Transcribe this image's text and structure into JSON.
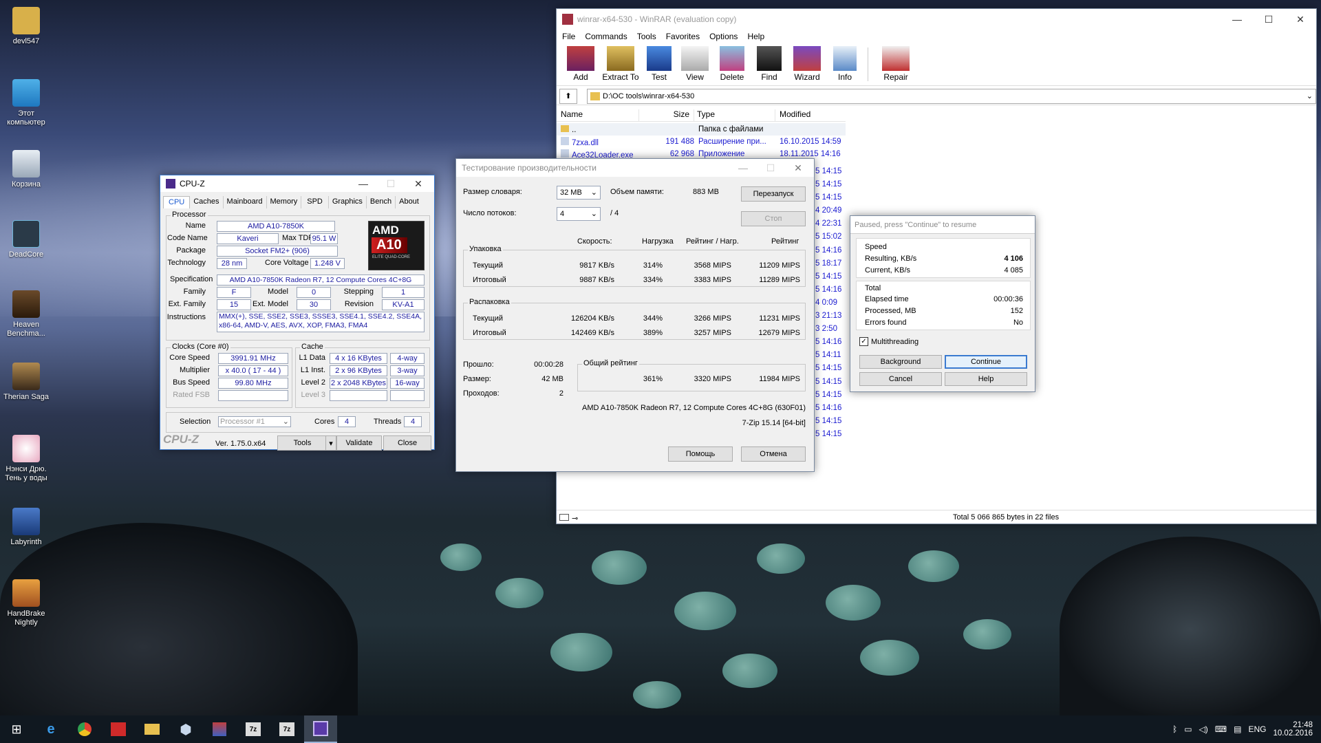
{
  "desktop": {
    "icons": [
      {
        "label": "devl547",
        "name": "user-folder-icon"
      },
      {
        "label": "Этот компьютер",
        "name": "this-pc-icon"
      },
      {
        "label": "Корзина",
        "name": "recycle-bin-icon"
      },
      {
        "label": "DeadCore",
        "name": "deadcore-icon"
      },
      {
        "label": "Heaven Benchma...",
        "name": "heaven-benchmark-icon"
      },
      {
        "label": "Therian Saga",
        "name": "therian-saga-icon"
      },
      {
        "label": "Нэнси Дрю. Тень у воды",
        "name": "nancy-drew-icon"
      },
      {
        "label": "Labyrinth",
        "name": "labyrinth-icon"
      },
      {
        "label": "HandBrake Nightly",
        "name": "handbrake-icon"
      }
    ]
  },
  "winrar": {
    "title": "winrar-x64-530 - WinRAR (evaluation copy)",
    "menu": [
      "File",
      "Commands",
      "Tools",
      "Favorites",
      "Options",
      "Help"
    ],
    "toolbar": [
      "Add",
      "Extract To",
      "Test",
      "View",
      "Delete",
      "Find",
      "Wizard",
      "Info",
      "Repair"
    ],
    "path": "D:\\OC tools\\winrar-x64-530",
    "columns": [
      "Name",
      "Size",
      "Type",
      "Modified"
    ],
    "rows": [
      {
        "name": "..",
        "size": "",
        "type": "Папка с файлами",
        "modified": ""
      },
      {
        "name": "7zxa.dll",
        "size": "191 488",
        "type": "Расширение при...",
        "modified": "16.10.2015 14:59"
      },
      {
        "name": "Ace32Loader.exe",
        "size": "62 968",
        "type": "Приложение",
        "modified": "18.11.2015 14:16"
      }
    ],
    "partial_dates": [
      "5 14:15",
      "5 14:15",
      "5 14:15",
      "4 20:49",
      "4 22:31",
      "5 15:02",
      "5 14:16",
      "5 18:17",
      "5 14:15",
      "5 14:16",
      "4 0:09",
      "3 21:13",
      "3 2:50",
      "5 14:16",
      "5 14:11",
      "5 14:15",
      "5 14:15",
      "5 14:15",
      "5 14:16",
      "5 14:15",
      "5 14:15"
    ],
    "status": "Total 5 066 865 bytes in 22 files"
  },
  "cpuz": {
    "title": "CPU-Z",
    "tabs": [
      "CPU",
      "Caches",
      "Mainboard",
      "Memory",
      "SPD",
      "Graphics",
      "Bench",
      "About"
    ],
    "processor_group": "Processor",
    "name_label": "Name",
    "name": "AMD A10-7850K",
    "codename_label": "Code Name",
    "codename": "Kaveri",
    "maxtdp_label": "Max TDP",
    "maxtdp": "95.1 W",
    "package_label": "Package",
    "package": "Socket FM2+ (906)",
    "tech_label": "Technology",
    "tech": "28 nm",
    "voltage_label": "Core Voltage",
    "voltage": "1.248 V",
    "spec_label": "Specification",
    "spec": "AMD A10-7850K Radeon R7, 12 Compute Cores 4C+8G",
    "family_label": "Family",
    "family": "F",
    "model_label": "Model",
    "model": "0",
    "stepping_label": "Stepping",
    "stepping": "1",
    "extfamily_label": "Ext. Family",
    "extfamily": "15",
    "extmodel_label": "Ext. Model",
    "extmodel": "30",
    "revision_label": "Revision",
    "revision": "KV-A1",
    "instr_label": "Instructions",
    "instructions": "MMX(+), SSE, SSE2, SSE3, SSSE3, SSE4.1, SSE4.2, SSE4A, x86-64, AMD-V, AES, AVX, XOP, FMA3, FMA4",
    "clocks_group": "Clocks (Core #0)",
    "corespeed_label": "Core Speed",
    "corespeed": "3991.91 MHz",
    "multiplier_label": "Multiplier",
    "multiplier": "x 40.0 ( 17 - 44 )",
    "busspeed_label": "Bus Speed",
    "busspeed": "99.80 MHz",
    "ratedfsb_label": "Rated FSB",
    "cache_group": "Cache",
    "l1d_label": "L1 Data",
    "l1d": "4 x 16 KBytes",
    "l1d_way": "4-way",
    "l1i_label": "L1 Inst.",
    "l1i": "2 x 96 KBytes",
    "l1i_way": "3-way",
    "l2_label": "Level 2",
    "l2": "2 x 2048 KBytes",
    "l2_way": "16-way",
    "l3_label": "Level 3",
    "selection_label": "Selection",
    "selection": "Processor #1",
    "cores_label": "Cores",
    "cores": "4",
    "threads_label": "Threads",
    "threads": "4",
    "brand": "CPU-Z",
    "version": "Ver. 1.75.0.x64",
    "tools_btn": "Tools",
    "validate_btn": "Validate",
    "close_btn": "Close",
    "logo_amd": "AMD",
    "logo_a10": "A10",
    "logo_sub": "ELITE QUAD-CORE"
  },
  "bench": {
    "title": "Тестирование производительности",
    "dict_label": "Размер словаря:",
    "dict": "32 MB",
    "mem_label": "Объем памяти:",
    "mem": "883 MB",
    "restart_btn": "Перезапуск",
    "threads_label": "Число потоков:",
    "threads": "4",
    "threads_of": "/ 4",
    "stop_btn": "Стоп",
    "col_speed": "Скорость:",
    "col_load": "Нагрузка",
    "col_rating_load": "Рейтинг / Нагр.",
    "col_rating": "Рейтинг",
    "pack_label": "Упаковка",
    "pack_cur": {
      "label": "Текущий",
      "speed": "9817 KB/s",
      "load": "314%",
      "rl": "3568 MIPS",
      "rating": "11209 MIPS"
    },
    "pack_tot": {
      "label": "Итоговый",
      "speed": "9887 KB/s",
      "load": "334%",
      "rl": "3383 MIPS",
      "rating": "11289 MIPS"
    },
    "unpack_label": "Распаковка",
    "unpack_cur": {
      "label": "Текущий",
      "speed": "126204 KB/s",
      "load": "344%",
      "rl": "3266 MIPS",
      "rating": "11231 MIPS"
    },
    "unpack_tot": {
      "label": "Итоговый",
      "speed": "142469 KB/s",
      "load": "389%",
      "rl": "3257 MIPS",
      "rating": "12679 MIPS"
    },
    "elapsed_label": "Прошло:",
    "elapsed": "00:00:28",
    "size_label": "Размер:",
    "size": "42 MB",
    "passes_label": "Проходов:",
    "passes": "2",
    "overall_label": "Общий рейтинг",
    "overall_load": "361%",
    "overall_rl": "3320 MIPS",
    "overall_rating": "11984 MIPS",
    "cpu_info": "AMD A10-7850K Radeon R7, 12 Compute Cores 4C+8G (630F01)",
    "version": "7-Zip 15.14 [64-bit]",
    "help_btn": "Помощь",
    "cancel_btn": "Отмена"
  },
  "paused": {
    "title": "Paused, press \"Continue\" to resume",
    "speed_group": "Speed",
    "resulting_label": "Resulting, KB/s",
    "resulting": "4 106",
    "current_label": "Current, KB/s",
    "current": "4 085",
    "total_group": "Total",
    "elapsed_label": "Elapsed time",
    "elapsed": "00:00:36",
    "processed_label": "Processed, MB",
    "processed": "152",
    "errors_label": "Errors found",
    "errors": "No",
    "mt_label": "Multithreading",
    "background_btn": "Background",
    "continue_btn": "Continue",
    "cancel_btn": "Cancel",
    "help_btn": "Help"
  },
  "taskbar": {
    "lang": "ENG",
    "time": "21:48",
    "date": "10.02.2016"
  }
}
